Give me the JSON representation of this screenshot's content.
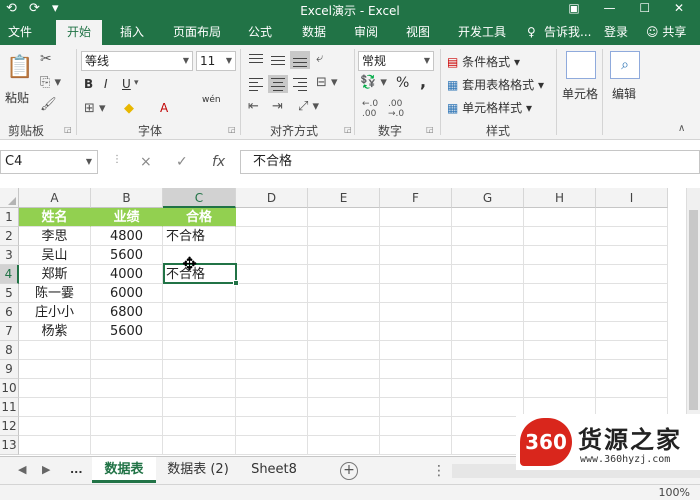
{
  "window": {
    "title": "Excel演示 - Excel"
  },
  "tabs": [
    {
      "label": "文件"
    },
    {
      "label": "开始"
    },
    {
      "label": "插入"
    },
    {
      "label": "页面布局"
    },
    {
      "label": "公式"
    },
    {
      "label": "数据"
    },
    {
      "label": "审阅"
    },
    {
      "label": "视图"
    },
    {
      "label": "开发工具"
    }
  ],
  "tell_me": "告诉我...",
  "login": "登录",
  "share": "共享",
  "ribbon": {
    "paste": "粘贴",
    "font_name": "等线",
    "font_size": "11",
    "number_format": "常规",
    "bold": "B",
    "italic": "I",
    "underline": "U",
    "font_color_letter": "A",
    "wen": "wén",
    "percent": "%",
    "comma": ",",
    "conditional_format": "条件格式",
    "table_format": "套用表格格式",
    "cell_style": "单元格样式",
    "cells": "单元格",
    "edit": "编辑",
    "groups": {
      "clipboard": "剪贴板",
      "font": "字体",
      "alignment": "对齐方式",
      "number": "数字",
      "styles": "样式"
    }
  },
  "formula_bar": {
    "name_box": "C4",
    "content": "不合格",
    "fx": "fx",
    "cancel": "×",
    "enter": "✓"
  },
  "columns": [
    "A",
    "B",
    "C",
    "D",
    "E",
    "F",
    "G",
    "H",
    "I"
  ],
  "rows": [
    "1",
    "2",
    "3",
    "4",
    "5",
    "6",
    "7",
    "8",
    "9",
    "10",
    "11",
    "12",
    "13"
  ],
  "table": {
    "headers": [
      "姓名",
      "业绩",
      "合格"
    ],
    "rows": [
      [
        "李思",
        "4800",
        "不合格"
      ],
      [
        "吴山",
        "5600",
        ""
      ],
      [
        "郑斯",
        "4000",
        "不合格"
      ],
      [
        "陈一霎",
        "6000",
        ""
      ],
      [
        "庄小小",
        "6800",
        ""
      ],
      [
        "杨紫",
        "5600",
        ""
      ]
    ]
  },
  "sheets": {
    "ellipsis": "...",
    "tabs": [
      "数据表",
      "数据表 (2)",
      "Sheet8"
    ],
    "active_index": 0,
    "add": "+"
  },
  "status": {
    "zoom": "100%"
  },
  "watermark": {
    "logo": "360",
    "name": "货源之家",
    "url": "www.360hyzj.com"
  }
}
